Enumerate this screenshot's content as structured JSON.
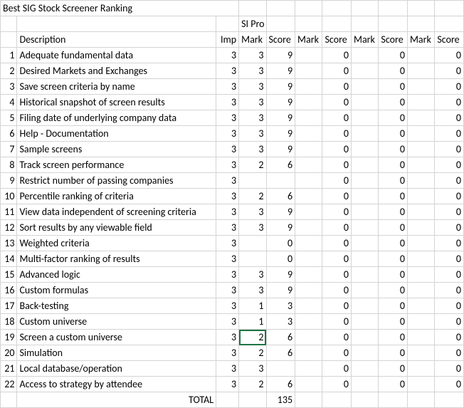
{
  "title": "Best SIG Stock Screener Ranking",
  "col_headers": {
    "description": "Description",
    "imp": "Imp",
    "group1": "SI Pro",
    "mark": "Mark",
    "score": "Score"
  },
  "total_label": "TOTAL",
  "total_value": 135,
  "zero": "0",
  "active_cell_value": "2",
  "rows": [
    {
      "n": 1,
      "desc": "Adequate fundamental data",
      "imp": 3,
      "mark": 3,
      "score": 9
    },
    {
      "n": 2,
      "desc": "Desired Markets and Exchanges",
      "imp": 3,
      "mark": 3,
      "score": 9
    },
    {
      "n": 3,
      "desc": "Save screen criteria by name",
      "imp": 3,
      "mark": 3,
      "score": 9
    },
    {
      "n": 4,
      "desc": "Historical snapshot of screen results",
      "imp": 3,
      "mark": 3,
      "score": 9
    },
    {
      "n": 5,
      "desc": "Filing date of underlying company data",
      "imp": 3,
      "mark": 3,
      "score": 9
    },
    {
      "n": 6,
      "desc": "Help - Documentation",
      "imp": 3,
      "mark": 3,
      "score": 9
    },
    {
      "n": 7,
      "desc": "Sample screens",
      "imp": 3,
      "mark": 3,
      "score": 9
    },
    {
      "n": 8,
      "desc": "Track screen performance",
      "imp": 3,
      "mark": 2,
      "score": 6
    },
    {
      "n": 9,
      "desc": "Restrict number of passing companies",
      "imp": 3,
      "mark": "",
      "score": ""
    },
    {
      "n": 10,
      "desc": "Percentile ranking of criteria",
      "imp": 3,
      "mark": 2,
      "score": 6
    },
    {
      "n": 11,
      "desc": "View data independent of screening criteria",
      "imp": 3,
      "mark": 3,
      "score": 9
    },
    {
      "n": 12,
      "desc": "Sort results by any viewable field",
      "imp": 3,
      "mark": 3,
      "score": 9
    },
    {
      "n": 13,
      "desc": "Weighted criteria",
      "imp": 3,
      "mark": "",
      "score": 0
    },
    {
      "n": 14,
      "desc": "Multi-factor ranking of results",
      "imp": 3,
      "mark": "",
      "score": 0
    },
    {
      "n": 15,
      "desc": "Advanced logic",
      "imp": 3,
      "mark": 3,
      "score": 9
    },
    {
      "n": 16,
      "desc": "Custom formulas",
      "imp": 3,
      "mark": 3,
      "score": 9
    },
    {
      "n": 17,
      "desc": "Back-testing",
      "imp": 3,
      "mark": 1,
      "score": 3
    },
    {
      "n": 18,
      "desc": "Custom universe",
      "imp": 3,
      "mark": 1,
      "score": 3
    },
    {
      "n": 19,
      "desc": "Screen a custom universe",
      "imp": 3,
      "mark": 2,
      "score": 6
    },
    {
      "n": 20,
      "desc": "Simulation",
      "imp": 3,
      "mark": 2,
      "score": 6
    },
    {
      "n": 21,
      "desc": "Local database/operation",
      "imp": 3,
      "mark": 3,
      "score": ""
    },
    {
      "n": 22,
      "desc": "Access to strategy by attendee",
      "imp": 3,
      "mark": 2,
      "score": 6
    }
  ]
}
